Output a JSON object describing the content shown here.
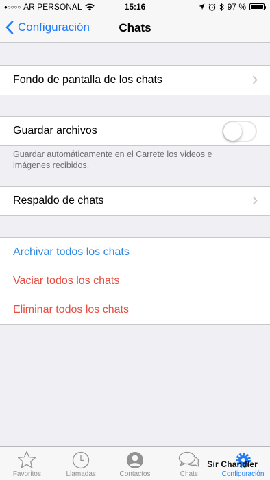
{
  "status_bar": {
    "signal": "●○○○○",
    "carrier": "AR PERSONAL",
    "time": "15:16",
    "battery": "97 %"
  },
  "nav": {
    "back_label": "Configuración",
    "title": "Chats"
  },
  "settings": {
    "wallpaper_label": "Fondo de pantalla de los chats",
    "save_files_label": "Guardar archivos",
    "save_files_on": false,
    "save_files_note": "Guardar automáticamente en el Carrete los videos e imágenes recibidos.",
    "backup_label": "Respaldo de chats",
    "archive_all_label": "Archivar todos los chats",
    "clear_all_label": "Vaciar todos los chats",
    "delete_all_label": "Eliminar todos los chats"
  },
  "tabs": [
    {
      "label": "Favoritos",
      "icon": "star-icon"
    },
    {
      "label": "Llamadas",
      "icon": "clock-icon"
    },
    {
      "label": "Contactos",
      "icon": "contact-icon"
    },
    {
      "label": "Chats",
      "icon": "chat-bubbles-icon"
    },
    {
      "label": "Configuración",
      "icon": "gear-icon",
      "active": true
    }
  ],
  "watermark": "Sir Chandler",
  "colors": {
    "accent_blue": "#1f7bf6",
    "destructive_red": "#e84d3f",
    "background": "#efeff4"
  }
}
